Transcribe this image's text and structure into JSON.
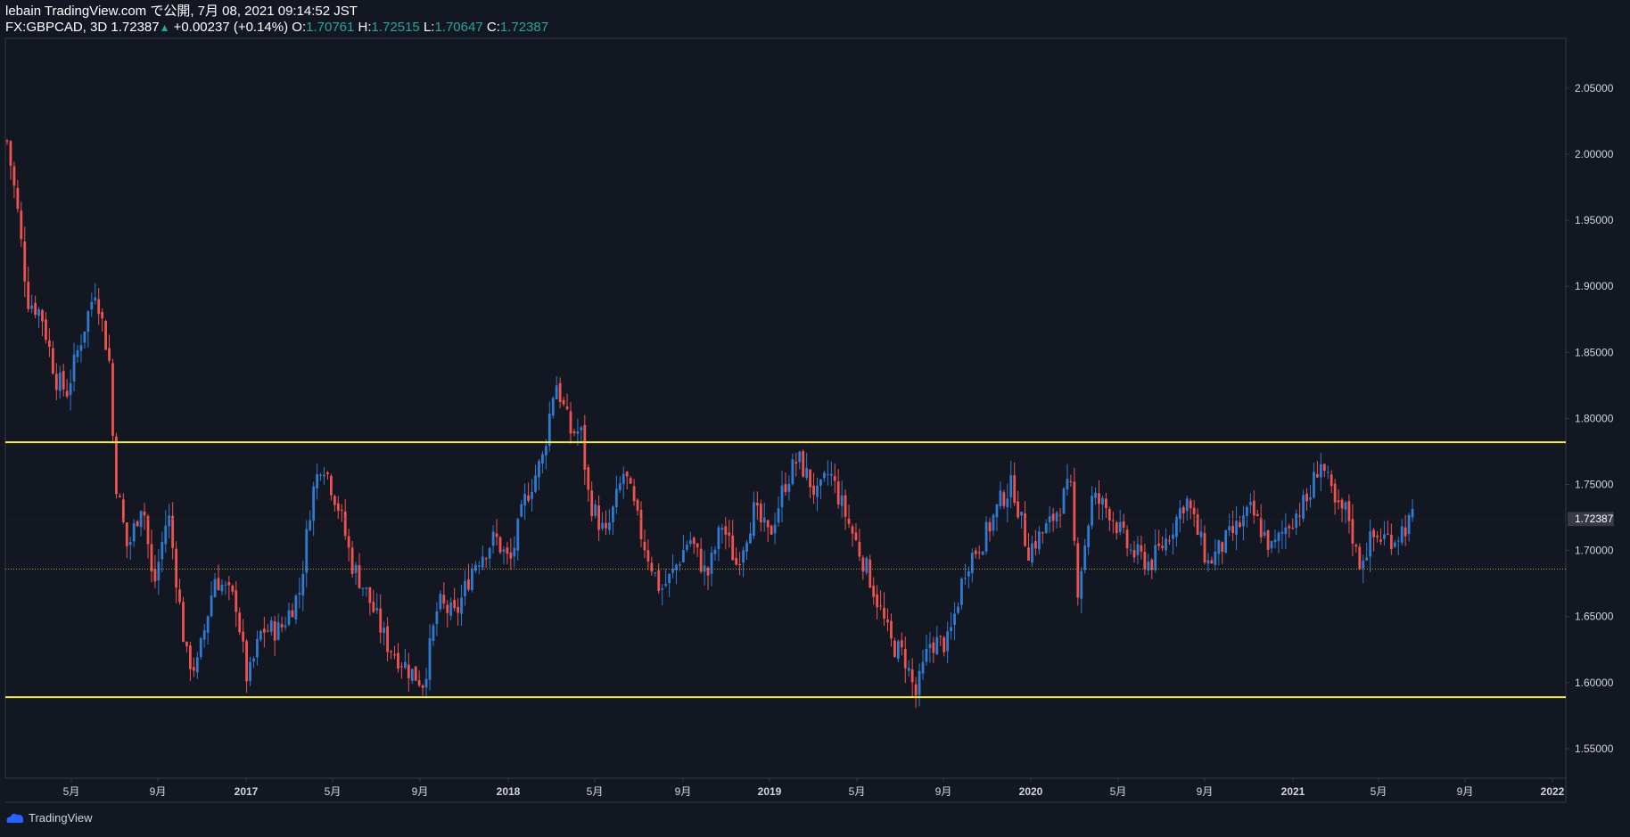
{
  "header": {
    "publish_line": "lebain TradingView.com で公開, 7月 08, 2021 09:14:52 JST",
    "symbol": "FX:GBPCAD, 3D",
    "last": "1.72387",
    "change": "+0.00237 (+0.14%)",
    "o_label": "O:",
    "o_val": "1.70761",
    "h_label": "H:",
    "h_val": "1.72515",
    "l_label": "L:",
    "l_val": "1.70647",
    "c_label": "C:",
    "c_val": "1.72387"
  },
  "footer": {
    "brand": "TradingView"
  },
  "colors": {
    "background": "#131722",
    "up": "#2e7bd1",
    "down": "#ef5350",
    "level": "#f7e84a",
    "text": "#d1d4dc",
    "price_tag": "#363a45"
  },
  "chart_data": {
    "type": "candlestick",
    "symbol": "FX:GBPCAD",
    "timeframe": "3D",
    "x_ticks": [
      "5月",
      "9月",
      "2017",
      "5月",
      "9月",
      "2018",
      "5月",
      "9月",
      "2019",
      "5月",
      "9月",
      "2020",
      "5月",
      "9月",
      "2021",
      "5月",
      "9月",
      "2022"
    ],
    "y_ticks": [
      "2.05000",
      "2.00000",
      "1.95000",
      "1.90000",
      "1.85000",
      "1.80000",
      "1.75000",
      "1.70000",
      "1.65000",
      "1.60000",
      "1.55000"
    ],
    "ylim": [
      1.52,
      2.08
    ],
    "xlim": [
      "2016-02-01",
      "2022-01-20"
    ],
    "current_price": "1.72387",
    "horizontal_levels": [
      {
        "price": 1.782,
        "color": "#f7e84a",
        "style": "solid"
      },
      {
        "price": 1.589,
        "color": "#f7e84a",
        "style": "solid"
      },
      {
        "price": 1.686,
        "color": "#b5a642",
        "style": "dotted"
      }
    ],
    "path_points": [
      {
        "date": "2016-02-01",
        "price": 2.01
      },
      {
        "date": "2016-02-15",
        "price": 1.96
      },
      {
        "date": "2016-03-01",
        "price": 1.89
      },
      {
        "date": "2016-03-20",
        "price": 1.88
      },
      {
        "date": "2016-04-10",
        "price": 1.83
      },
      {
        "date": "2016-04-25",
        "price": 1.82
      },
      {
        "date": "2016-05-15",
        "price": 1.86
      },
      {
        "date": "2016-06-05",
        "price": 1.9
      },
      {
        "date": "2016-06-25",
        "price": 1.84
      },
      {
        "date": "2016-07-01",
        "price": 1.76
      },
      {
        "date": "2016-07-20",
        "price": 1.7
      },
      {
        "date": "2016-08-10",
        "price": 1.74
      },
      {
        "date": "2016-08-25",
        "price": 1.67
      },
      {
        "date": "2016-09-15",
        "price": 1.73
      },
      {
        "date": "2016-10-10",
        "price": 1.62
      },
      {
        "date": "2016-10-25",
        "price": 1.61
      },
      {
        "date": "2016-11-20",
        "price": 1.68
      },
      {
        "date": "2016-12-20",
        "price": 1.66
      },
      {
        "date": "2017-01-05",
        "price": 1.6
      },
      {
        "date": "2017-01-25",
        "price": 1.64
      },
      {
        "date": "2017-02-20",
        "price": 1.64
      },
      {
        "date": "2017-03-20",
        "price": 1.67
      },
      {
        "date": "2017-04-05",
        "price": 1.74
      },
      {
        "date": "2017-04-20",
        "price": 1.77
      },
      {
        "date": "2017-05-15",
        "price": 1.73
      },
      {
        "date": "2017-06-01",
        "price": 1.69
      },
      {
        "date": "2017-06-20",
        "price": 1.67
      },
      {
        "date": "2017-07-20",
        "price": 1.63
      },
      {
        "date": "2017-08-20",
        "price": 1.61
      },
      {
        "date": "2017-09-10",
        "price": 1.6
      },
      {
        "date": "2017-10-01",
        "price": 1.66
      },
      {
        "date": "2017-10-25",
        "price": 1.65
      },
      {
        "date": "2017-11-20",
        "price": 1.69
      },
      {
        "date": "2017-12-20",
        "price": 1.71
      },
      {
        "date": "2018-01-10",
        "price": 1.69
      },
      {
        "date": "2018-02-01",
        "price": 1.74
      },
      {
        "date": "2018-02-25",
        "price": 1.77
      },
      {
        "date": "2018-03-15",
        "price": 1.83
      },
      {
        "date": "2018-04-05",
        "price": 1.79
      },
      {
        "date": "2018-04-20",
        "price": 1.79
      },
      {
        "date": "2018-05-01",
        "price": 1.74
      },
      {
        "date": "2018-05-25",
        "price": 1.71
      },
      {
        "date": "2018-06-20",
        "price": 1.76
      },
      {
        "date": "2018-07-15",
        "price": 1.71
      },
      {
        "date": "2018-08-10",
        "price": 1.67
      },
      {
        "date": "2018-08-25",
        "price": 1.68
      },
      {
        "date": "2018-09-20",
        "price": 1.71
      },
      {
        "date": "2018-10-15",
        "price": 1.68
      },
      {
        "date": "2018-11-05",
        "price": 1.72
      },
      {
        "date": "2018-11-25",
        "price": 1.69
      },
      {
        "date": "2018-12-20",
        "price": 1.73
      },
      {
        "date": "2019-01-10",
        "price": 1.71
      },
      {
        "date": "2019-02-01",
        "price": 1.75
      },
      {
        "date": "2019-02-20",
        "price": 1.77
      },
      {
        "date": "2019-03-20",
        "price": 1.74
      },
      {
        "date": "2019-04-05",
        "price": 1.76
      },
      {
        "date": "2019-05-10",
        "price": 1.71
      },
      {
        "date": "2019-06-01",
        "price": 1.68
      },
      {
        "date": "2019-07-01",
        "price": 1.63
      },
      {
        "date": "2019-07-20",
        "price": 1.62
      },
      {
        "date": "2019-08-05",
        "price": 1.59
      },
      {
        "date": "2019-08-25",
        "price": 1.63
      },
      {
        "date": "2019-09-20",
        "price": 1.63
      },
      {
        "date": "2019-10-15",
        "price": 1.69
      },
      {
        "date": "2019-11-10",
        "price": 1.71
      },
      {
        "date": "2019-12-05",
        "price": 1.74
      },
      {
        "date": "2019-12-20",
        "price": 1.75
      },
      {
        "date": "2020-01-10",
        "price": 1.7
      },
      {
        "date": "2020-02-10",
        "price": 1.72
      },
      {
        "date": "2020-03-10",
        "price": 1.75
      },
      {
        "date": "2020-03-20",
        "price": 1.67
      },
      {
        "date": "2020-04-10",
        "price": 1.74
      },
      {
        "date": "2020-05-05",
        "price": 1.73
      },
      {
        "date": "2020-06-01",
        "price": 1.7
      },
      {
        "date": "2020-07-01",
        "price": 1.69
      },
      {
        "date": "2020-07-25",
        "price": 1.71
      },
      {
        "date": "2020-08-20",
        "price": 1.74
      },
      {
        "date": "2020-09-20",
        "price": 1.69
      },
      {
        "date": "2020-10-20",
        "price": 1.71
      },
      {
        "date": "2020-11-20",
        "price": 1.73
      },
      {
        "date": "2020-12-20",
        "price": 1.7
      },
      {
        "date": "2021-01-10",
        "price": 1.72
      },
      {
        "date": "2021-02-10",
        "price": 1.74
      },
      {
        "date": "2021-02-25",
        "price": 1.77
      },
      {
        "date": "2021-03-20",
        "price": 1.73
      },
      {
        "date": "2021-04-05",
        "price": 1.73
      },
      {
        "date": "2021-04-20",
        "price": 1.69
      },
      {
        "date": "2021-05-10",
        "price": 1.71
      },
      {
        "date": "2021-06-10",
        "price": 1.71
      },
      {
        "date": "2021-07-06",
        "price": 1.724
      }
    ]
  }
}
